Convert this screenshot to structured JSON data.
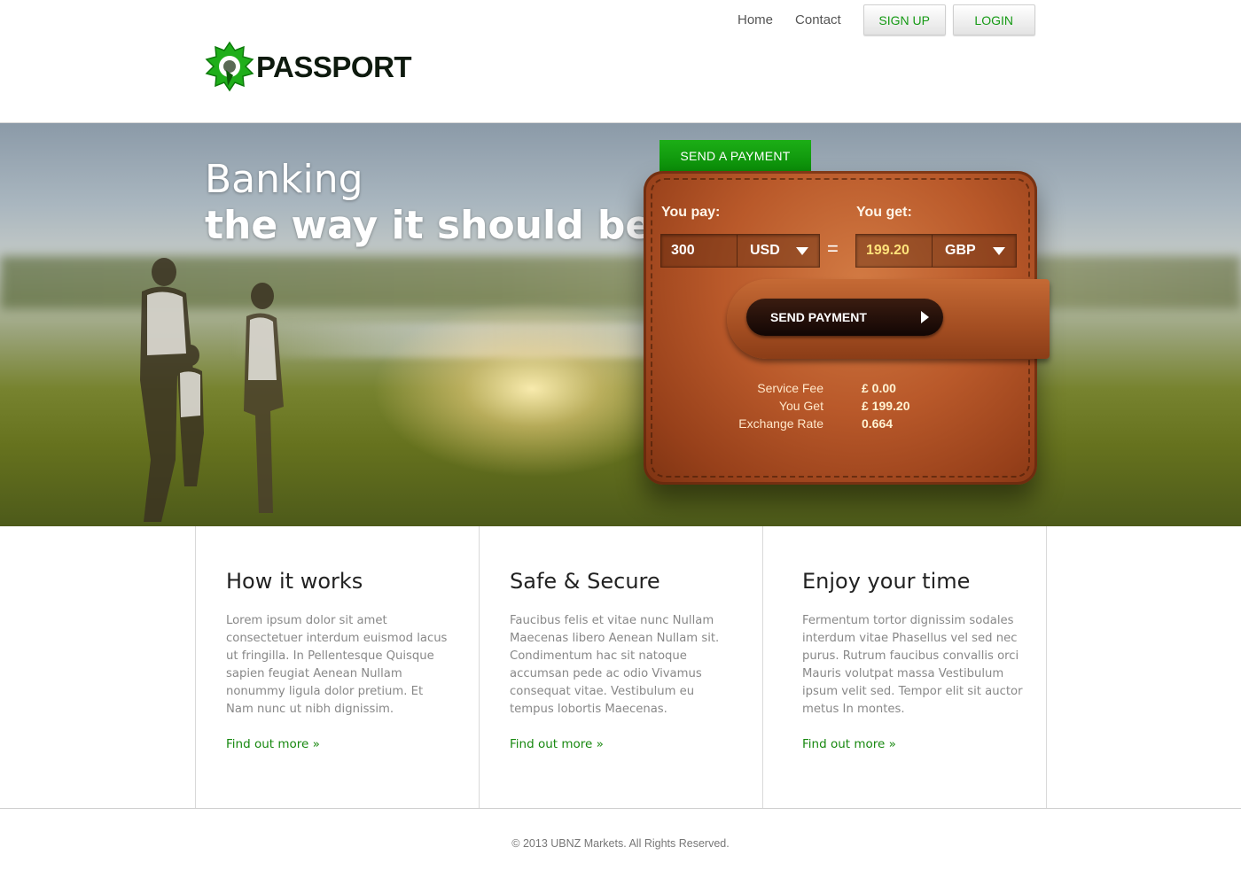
{
  "nav": {
    "home": "Home",
    "contact": "Contact",
    "signup": "SIGN UP",
    "login": "LOGIN"
  },
  "brand": {
    "name": "PASSPORT",
    "color": "#1a9a1a"
  },
  "hero": {
    "line1": "Banking",
    "line2": "the way it should be."
  },
  "payment": {
    "tab": "SEND A PAYMENT",
    "you_pay_label": "You pay:",
    "you_get_label": "You get:",
    "pay_amount": "300",
    "pay_currency": "USD",
    "get_amount": "199.20",
    "get_currency": "GBP",
    "equals": "=",
    "send_button": "SEND PAYMENT",
    "summary": [
      {
        "label": "Service Fee",
        "value": "£ 0.00"
      },
      {
        "label": "You Get",
        "value": "£ 199.20"
      },
      {
        "label": "Exchange Rate",
        "value": "0.664"
      }
    ]
  },
  "features": [
    {
      "title": "How it works",
      "body": "Lorem ipsum dolor sit amet consectetuer interdum euismod lacus ut fringilla. In Pellentesque Quisque sapien feugiat Aenean Nullam nonummy ligula dolor pretium. Et Nam nunc ut nibh dignissim.",
      "link": "Find out more »"
    },
    {
      "title": "Safe & Secure",
      "body": "Faucibus felis et vitae nunc Nullam Maecenas libero Aenean Nullam sit. Condimentum hac sit natoque accumsan pede ac odio Vivamus consequat vitae. Vestibulum eu tempus lobortis Maecenas.",
      "link": "Find out more »"
    },
    {
      "title": "Enjoy your time",
      "body": "Fermentum tortor dignissim sodales interdum vitae Phasellus vel sed nec purus. Rutrum faucibus convallis orci Mauris volutpat massa Vestibulum ipsum velit sed. Tempor elit sit auctor metus In montes.",
      "link": "Find out more »"
    }
  ],
  "footer": {
    "copyright": "© 2013 UBNZ Markets. All Rights Reserved."
  },
  "colors": {
    "accent_green": "#17880f",
    "leather": "#b9592a"
  }
}
